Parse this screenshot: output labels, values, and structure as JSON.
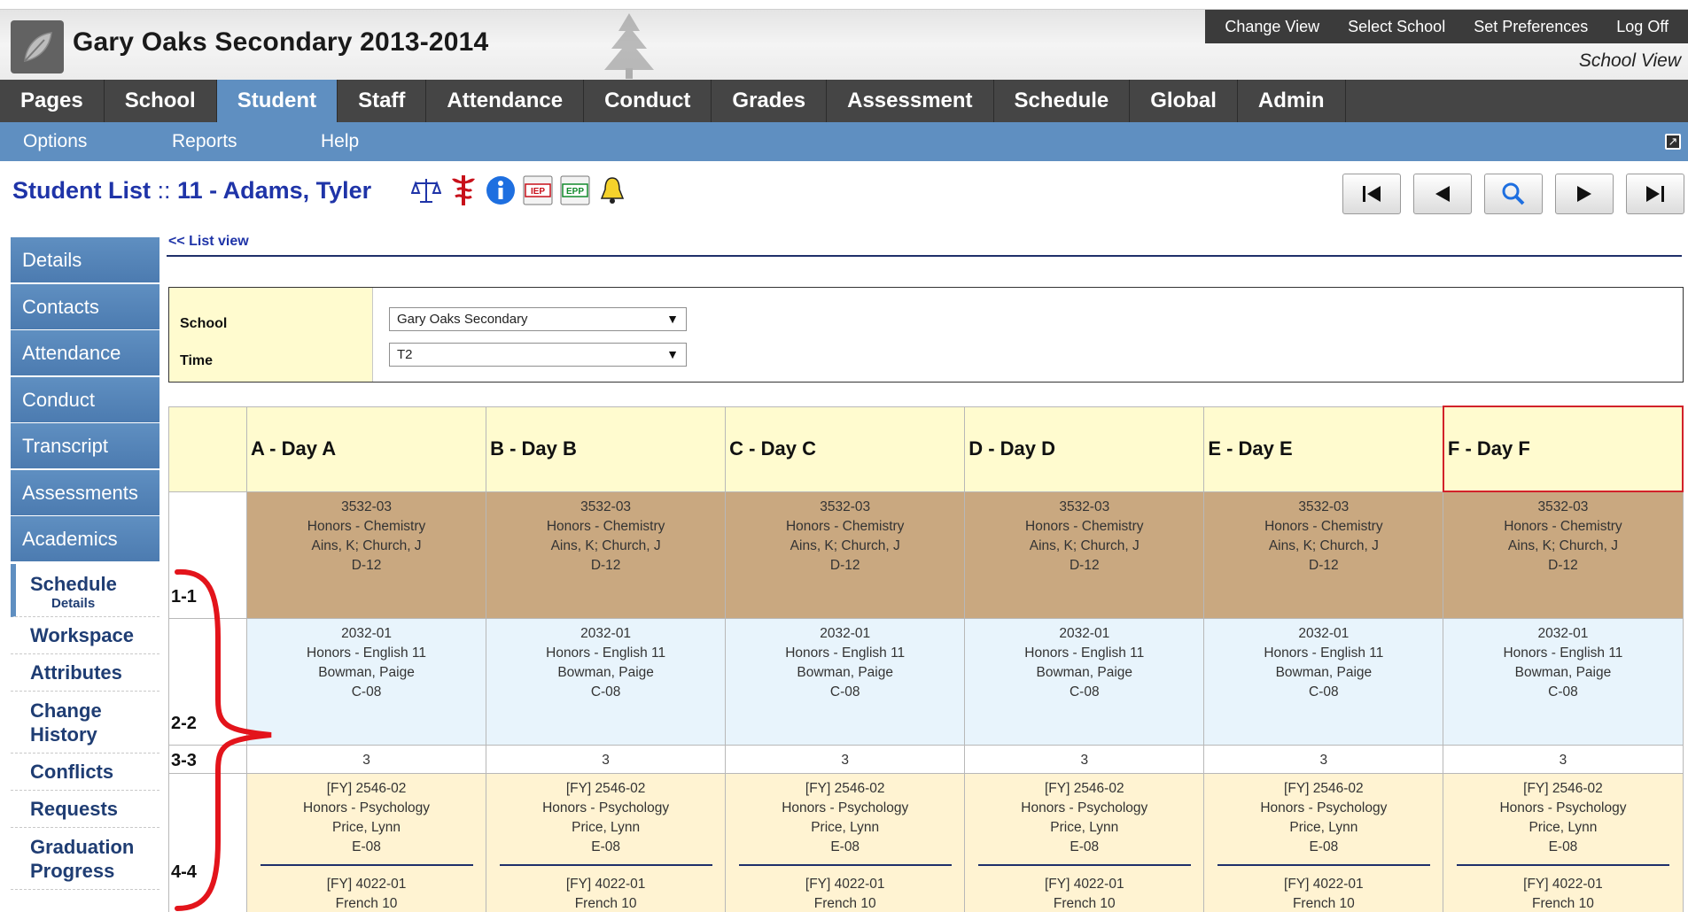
{
  "app": {
    "title": "Gary Oaks Secondary 2013-2014",
    "top_links": [
      "Change View",
      "Select School",
      "Set Preferences",
      "Log Off"
    ],
    "view_label": "School View"
  },
  "main_tabs": [
    "Pages",
    "School",
    "Student",
    "Staff",
    "Attendance",
    "Conduct",
    "Grades",
    "Assessment",
    "Schedule",
    "Global",
    "Admin"
  ],
  "active_tab": "Student",
  "sub_menu": [
    "Options",
    "Reports",
    "Help"
  ],
  "page": {
    "title_prefix": "Student List",
    "separator": "::",
    "title_student": "11 - Adams, Tyler",
    "icons": [
      "legal-scale-icon",
      "medical-caduceus-icon",
      "info-icon",
      "iep-document-icon",
      "epp-document-icon",
      "alert-bell-icon"
    ],
    "iep_label": "IEP",
    "epp_label": "EPP"
  },
  "record_nav": [
    "first-record-icon",
    "previous-record-icon",
    "search-icon",
    "next-record-icon",
    "last-record-icon"
  ],
  "side_nav": [
    "Details",
    "Contacts",
    "Attendance",
    "Conduct",
    "Transcript",
    "Assessments",
    "Academics"
  ],
  "side_sub": {
    "schedule": "Schedule",
    "schedule_details": "Details",
    "items": [
      "Workspace",
      "Attributes",
      "Change History",
      "Conflicts",
      "Requests",
      "Graduation Progress"
    ]
  },
  "content": {
    "list_view_link": "<< List view",
    "filters": {
      "school_label": "School",
      "school_value": "Gary Oaks Secondary",
      "time_label": "Time",
      "time_value": "T2"
    }
  },
  "schedule": {
    "days": [
      "A - Day A",
      "B - Day B",
      "C - Day C",
      "D - Day D",
      "E - Day E",
      "F - Day F"
    ],
    "selected_day": "F - Day F",
    "periods": [
      {
        "label": "1-1",
        "course": {
          "code": "3532-03",
          "name": "Honors - Chemistry",
          "teacher": "Ains, K; Church, J",
          "room": "D-12"
        }
      },
      {
        "label": "2-2",
        "course": {
          "code": "2032-01",
          "name": "Honors - English 11",
          "teacher": "Bowman, Paige",
          "room": "C-08"
        }
      },
      {
        "label": "3-3",
        "course": {
          "code": "3"
        }
      },
      {
        "label": "4-4",
        "course": {
          "code": "[FY] 2546-02",
          "name": "Honors - Psychology",
          "teacher": "Price, Lynn",
          "room": "E-08",
          "second_code": "[FY] 4022-01",
          "second_name": "French 10"
        }
      }
    ]
  },
  "colors": {
    "header_dark": "#454545",
    "accent_blue": "#5f8fc1",
    "title_blue": "#1f34a8",
    "period1_bg": "#c9a880",
    "period2_bg": "#e8f4fc",
    "period4_bg": "#fff3d2",
    "day_header_bg": "#fffbcf",
    "annotation_red": "#e3141b"
  }
}
